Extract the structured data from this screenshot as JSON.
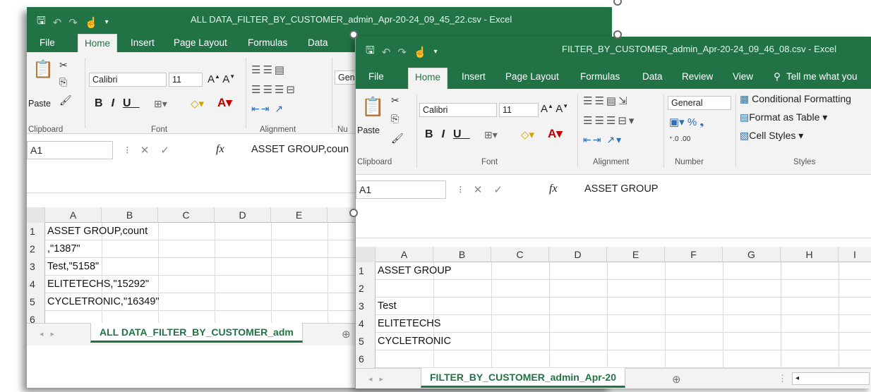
{
  "ribbon_tabs": [
    "File",
    "Home",
    "Insert",
    "Page Layout",
    "Formulas",
    "Data",
    "Review",
    "View"
  ],
  "tell_me": "Tell me what you",
  "clipboard": {
    "paste": "Paste",
    "label": "Clipboard"
  },
  "font": {
    "name": "Calibri",
    "size": "11",
    "label": "Font"
  },
  "alignment_label": "Alignment",
  "number": {
    "format": "General",
    "format_short": "Gen",
    "label": "Number",
    "label_short": "Nu"
  },
  "styles": {
    "conditional": "Conditional Formatting",
    "format_table": "Format as Table",
    "cell_styles": "Cell Styles",
    "label": "Styles"
  },
  "accent_color": "#217346",
  "window1": {
    "title": "ALL DATA_FILTER_BY_CUSTOMER_admin_Apr-20-24_09_45_22.csv - Excel",
    "name_box": "A1",
    "formula": "ASSET GROUP,coun",
    "columns": [
      "A",
      "B",
      "C",
      "D",
      "E"
    ],
    "rows": [
      {
        "num": "1",
        "a": "ASSET GROUP,count"
      },
      {
        "num": "2",
        "a": ",\"1387\""
      },
      {
        "num": "3",
        "a": "Test,\"5158\""
      },
      {
        "num": "4",
        "a": "ELITETECHS,\"15292\""
      },
      {
        "num": "5",
        "a": "CYCLETRONIC,\"16349\""
      },
      {
        "num": "6",
        "a": ""
      }
    ],
    "sheet_tab": "ALL DATA_FILTER_BY_CUSTOMER_adm"
  },
  "window2": {
    "title": "FILTER_BY_CUSTOMER_admin_Apr-20-24_09_46_08.csv - Excel",
    "name_box": "A1",
    "formula": "ASSET GROUP",
    "columns": [
      "A",
      "B",
      "C",
      "D",
      "E",
      "F",
      "G",
      "H",
      "I"
    ],
    "rows": [
      {
        "num": "1",
        "a": "ASSET GROUP"
      },
      {
        "num": "2",
        "a": ""
      },
      {
        "num": "3",
        "a": "Test"
      },
      {
        "num": "4",
        "a": "ELITETECHS"
      },
      {
        "num": "5",
        "a": "CYCLETRONIC"
      },
      {
        "num": "6",
        "a": ""
      }
    ],
    "sheet_tab": "FILTER_BY_CUSTOMER_admin_Apr-20"
  }
}
